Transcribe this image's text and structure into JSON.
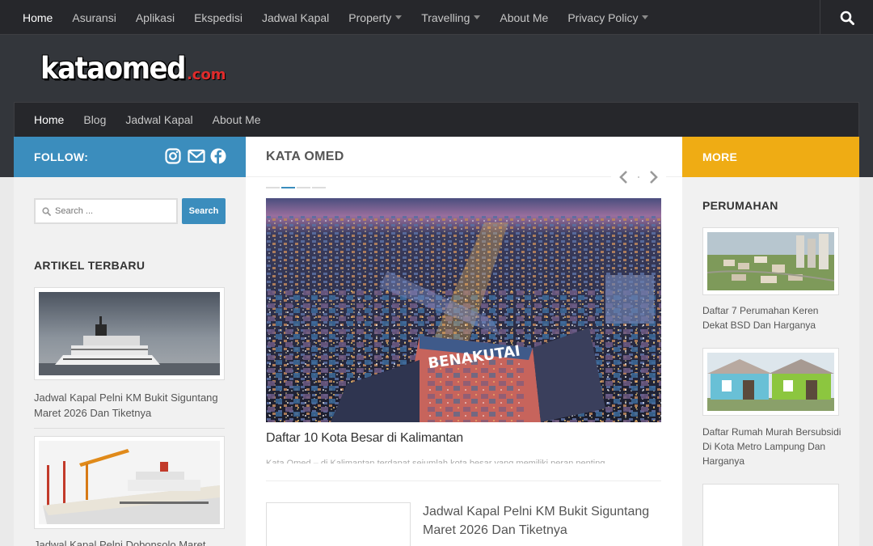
{
  "topnav": {
    "items": [
      {
        "label": "Home",
        "active": true,
        "dropdown": false
      },
      {
        "label": "Asuransi",
        "dropdown": false
      },
      {
        "label": "Aplikasi",
        "dropdown": false
      },
      {
        "label": "Ekspedisi",
        "dropdown": false
      },
      {
        "label": "Jadwal Kapal",
        "dropdown": false
      },
      {
        "label": "Property",
        "dropdown": true
      },
      {
        "label": "Travelling",
        "dropdown": true
      },
      {
        "label": "About Me",
        "dropdown": false
      },
      {
        "label": "Privacy Policy",
        "dropdown": true
      }
    ],
    "search_icon": "search-icon"
  },
  "logo": {
    "main": "kataomed",
    "ext": ".com"
  },
  "subnav": {
    "items": [
      {
        "label": "Home",
        "active": true
      },
      {
        "label": "Blog"
      },
      {
        "label": "Jadwal Kapal"
      },
      {
        "label": "About Me"
      }
    ]
  },
  "left": {
    "follow_label": "FOLLOW:",
    "social_icons": [
      "instagram-icon",
      "mail-icon",
      "facebook-icon"
    ],
    "search_placeholder": "Search ...",
    "search_button": "Search",
    "recent_title": "ARTIKEL TERBARU",
    "posts": [
      {
        "title": "Jadwal Kapal Pelni KM Bukit Siguntang Maret 2026 Dan Tiketnya"
      },
      {
        "title": "Jadwal Kapal Pelni Dobonsolo Maret"
      }
    ]
  },
  "main": {
    "heading": "KATA OMED",
    "slider_dots": 4,
    "slider_active": 1,
    "featured": {
      "title": "Daftar 10 Kota Besar di Kalimantan",
      "sign_text": "BENAKUTAI",
      "excerpt": "Kata Omed – di Kalimantan terdapat sejumlah kota besar yang memiliki peran penting"
    },
    "second": {
      "title": "Jadwal Kapal Pelni KM Bukit Siguntang Maret 2026 Dan Tiketnya"
    }
  },
  "right": {
    "more_label": "MORE",
    "section_title": "PERUMAHAN",
    "posts": [
      {
        "title": "Daftar 7 Perumahan Keren Dekat BSD Dan Harganya"
      },
      {
        "title": "Daftar Rumah Murah Bersubsidi Di Kota Metro Lampung Dan Harganya"
      }
    ]
  },
  "colors": {
    "topnav_bg": "#26272b",
    "header_bg": "#33363b",
    "follow_blue": "#3b8dbd",
    "more_orange": "#efac14",
    "logo_red": "#e02b2b"
  }
}
